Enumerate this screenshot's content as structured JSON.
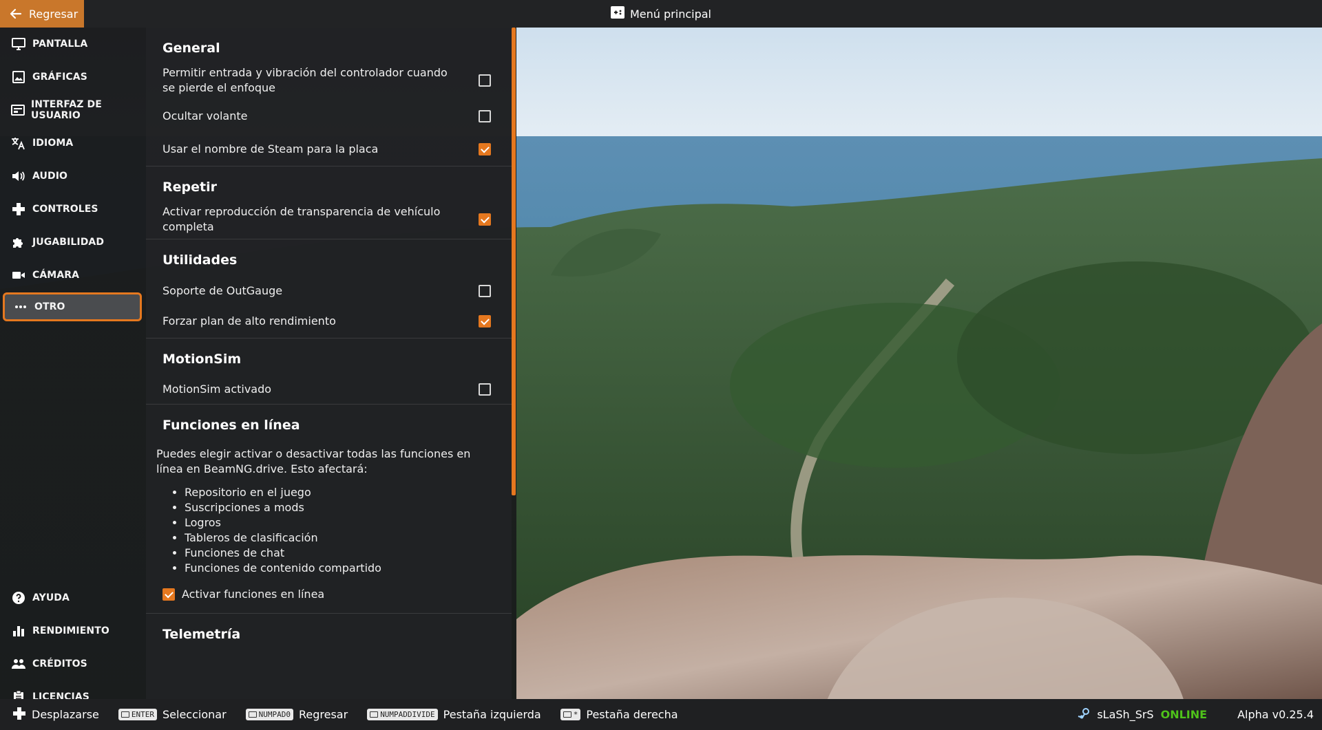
{
  "topbar": {
    "back_label": "Regresar",
    "title": "Menú principal"
  },
  "sidebar": {
    "top_items": [
      {
        "label": "PANTALLA",
        "icon": "monitor-icon"
      },
      {
        "label": "GRÁFICAS",
        "icon": "image-icon"
      },
      {
        "label": "INTERFAZ DE USUARIO",
        "icon": "ui-icon"
      },
      {
        "label": "IDIOMA",
        "icon": "translate-icon"
      },
      {
        "label": "AUDIO",
        "icon": "speaker-icon"
      },
      {
        "label": "CONTROLES",
        "icon": "gamepad-icon"
      },
      {
        "label": "JUGABILIDAD",
        "icon": "puzzle-icon"
      },
      {
        "label": "CÁMARA",
        "icon": "camera-icon"
      },
      {
        "label": "OTRO",
        "icon": "more-icon",
        "active": true
      }
    ],
    "bottom_items": [
      {
        "label": "AYUDA",
        "icon": "help-icon"
      },
      {
        "label": "RENDIMIENTO",
        "icon": "bar-chart-icon"
      },
      {
        "label": "CRÉDITOS",
        "icon": "people-icon"
      },
      {
        "label": "LICENCIAS",
        "icon": "clipboard-icon"
      }
    ]
  },
  "panel": {
    "general": {
      "title": "General",
      "rows": [
        {
          "label": "Permitir entrada y vibración del controlador cuando se pierde el enfoque",
          "checked": false
        },
        {
          "label": "Ocultar volante",
          "checked": false
        },
        {
          "label": "Usar el nombre de Steam para la placa",
          "checked": true
        }
      ]
    },
    "replay": {
      "title": "Repetir",
      "rows": [
        {
          "label": "Activar reproducción de transparencia de vehículo completa",
          "checked": true
        }
      ]
    },
    "utilities": {
      "title": "Utilidades",
      "rows": [
        {
          "label": "Soporte de OutGauge",
          "checked": false
        },
        {
          "label": "Forzar plan de alto rendimiento",
          "checked": true
        }
      ]
    },
    "motionsim": {
      "title": "MotionSim",
      "rows": [
        {
          "label": "MotionSim activado",
          "checked": false
        }
      ]
    },
    "online": {
      "title": "Funciones en línea",
      "description": "Puedes elegir activar o desactivar todas las funciones en línea en BeamNG.drive. Esto afectará:",
      "bullets": [
        "Repositorio en el juego",
        "Suscripciones a mods",
        "Logros",
        "Tableros de clasificación",
        "Funciones de chat",
        "Funciones de contenido compartido"
      ],
      "toggle": {
        "label": "Activar funciones en línea",
        "checked": true
      }
    },
    "telemetry": {
      "title": "Telemetría"
    }
  },
  "bottombar": {
    "hints": [
      {
        "key": "",
        "icon": "dpad-icon",
        "label": "Desplazarse"
      },
      {
        "key": "ENTER",
        "icon": "",
        "label": "Seleccionar"
      },
      {
        "key": "NUMPAD0",
        "icon": "",
        "label": "Regresar"
      },
      {
        "key": "NUMPADDIVIDE",
        "icon": "",
        "label": "Pestaña izquierda"
      },
      {
        "key": "*",
        "icon": "",
        "label": "Pestaña derecha"
      }
    ],
    "username": "sLaSh_SrS",
    "status": "ONLINE",
    "version": "Alpha v0.25.4"
  },
  "colors": {
    "accent": "#e5781f",
    "back_button": "#c9772b",
    "online": "#4fc21a"
  }
}
